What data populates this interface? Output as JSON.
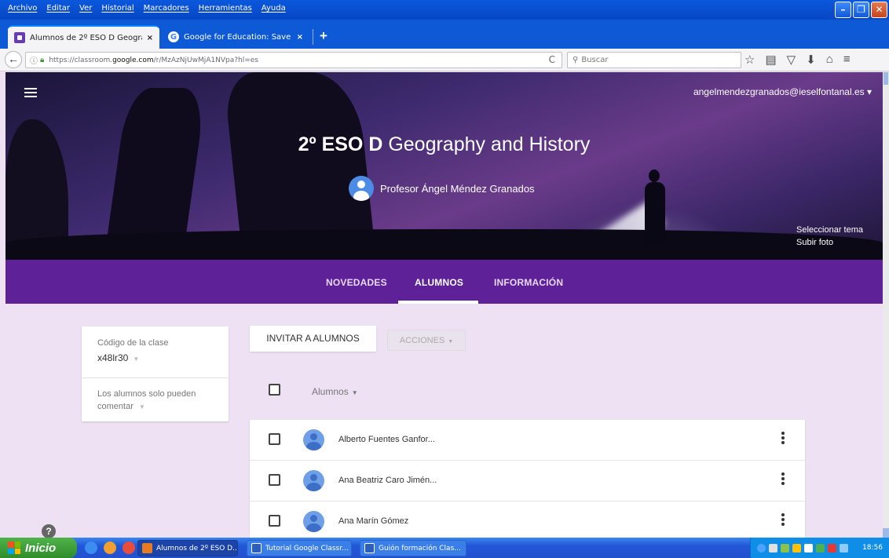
{
  "browser": {
    "menu": [
      "Archivo",
      "Editar",
      "Ver",
      "Historial",
      "Marcadores",
      "Herramientas",
      "Ayuda"
    ],
    "tabs": [
      {
        "title": "Alumnos de 2º ESO D Geogra...",
        "close": "×"
      },
      {
        "title": "Google for Education: Save ti...",
        "close": "×"
      }
    ],
    "new_tab": "+",
    "url_prefix": "https://classroom.",
    "url_host": "google.com",
    "url_suffix": "/r/MzAzNjUwMjA1NVpa?hl=es",
    "search_placeholder": "Buscar",
    "reload": "C"
  },
  "header": {
    "account": "angelmendezgranados@ieselfontanal.es",
    "title_bold": "2º ESO D",
    "title_rest": " Geography and History",
    "teacher": "Profesor Ángel Méndez Granados",
    "select_theme": "Seleccionar tema",
    "upload_photo": "Subir foto"
  },
  "class_tabs": [
    {
      "label": "NOVEDADES",
      "active": false
    },
    {
      "label": "ALUMNOS",
      "active": true
    },
    {
      "label": "INFORMACIÓN",
      "active": false
    }
  ],
  "sidebar": {
    "code_label": "Código de la clase",
    "code_value": "x48lr30",
    "permission": "Los alumnos solo pueden comentar"
  },
  "actions": {
    "invite": "INVITAR A ALUMNOS",
    "actions": "ACCIONES"
  },
  "list": {
    "header": "Alumnos",
    "students": [
      "Alberto Fuentes Ganfor...",
      "Ana Beatriz Caro Jimén...",
      "Ana Marín Gómez"
    ]
  },
  "taskbar": {
    "start": "Inicio",
    "tasks": [
      "Alumnos de 2º ESO D...",
      "Tutorial Google Classr...",
      "Guión formación Clas..."
    ],
    "clock": "18:56"
  },
  "colors": {
    "classroom_purple": "#5e2198",
    "page_background": "#ede1f3",
    "xp_blue": "#0a58dd"
  }
}
